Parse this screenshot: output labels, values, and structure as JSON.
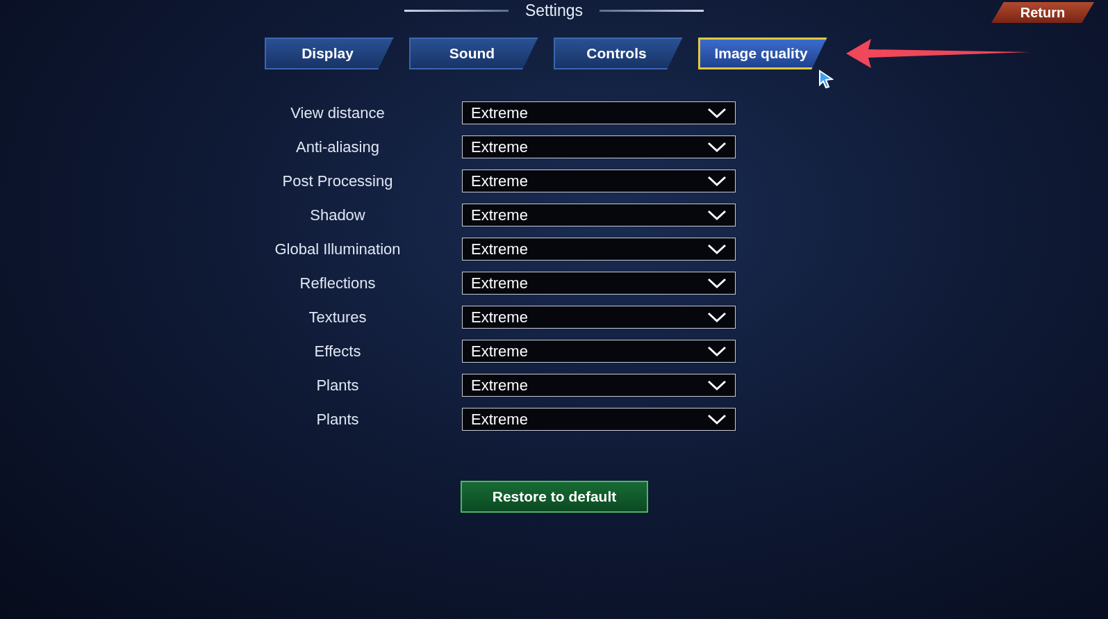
{
  "title": "Settings",
  "return_button": "Return",
  "tabs": [
    {
      "label": "Display",
      "selected": false
    },
    {
      "label": "Sound",
      "selected": false
    },
    {
      "label": "Controls",
      "selected": false
    },
    {
      "label": "Image quality",
      "selected": true
    }
  ],
  "settings": [
    {
      "label": "View distance",
      "value": "Extreme"
    },
    {
      "label": "Anti-aliasing",
      "value": "Extreme"
    },
    {
      "label": "Post Processing",
      "value": "Extreme"
    },
    {
      "label": "Shadow",
      "value": "Extreme"
    },
    {
      "label": "Global Illumination",
      "value": "Extreme"
    },
    {
      "label": "Reflections",
      "value": "Extreme"
    },
    {
      "label": "Textures",
      "value": "Extreme"
    },
    {
      "label": "Effects",
      "value": "Extreme"
    },
    {
      "label": "Plants",
      "value": "Extreme"
    },
    {
      "label": "Plants",
      "value": "Extreme"
    }
  ],
  "restore_button": "Restore to default"
}
